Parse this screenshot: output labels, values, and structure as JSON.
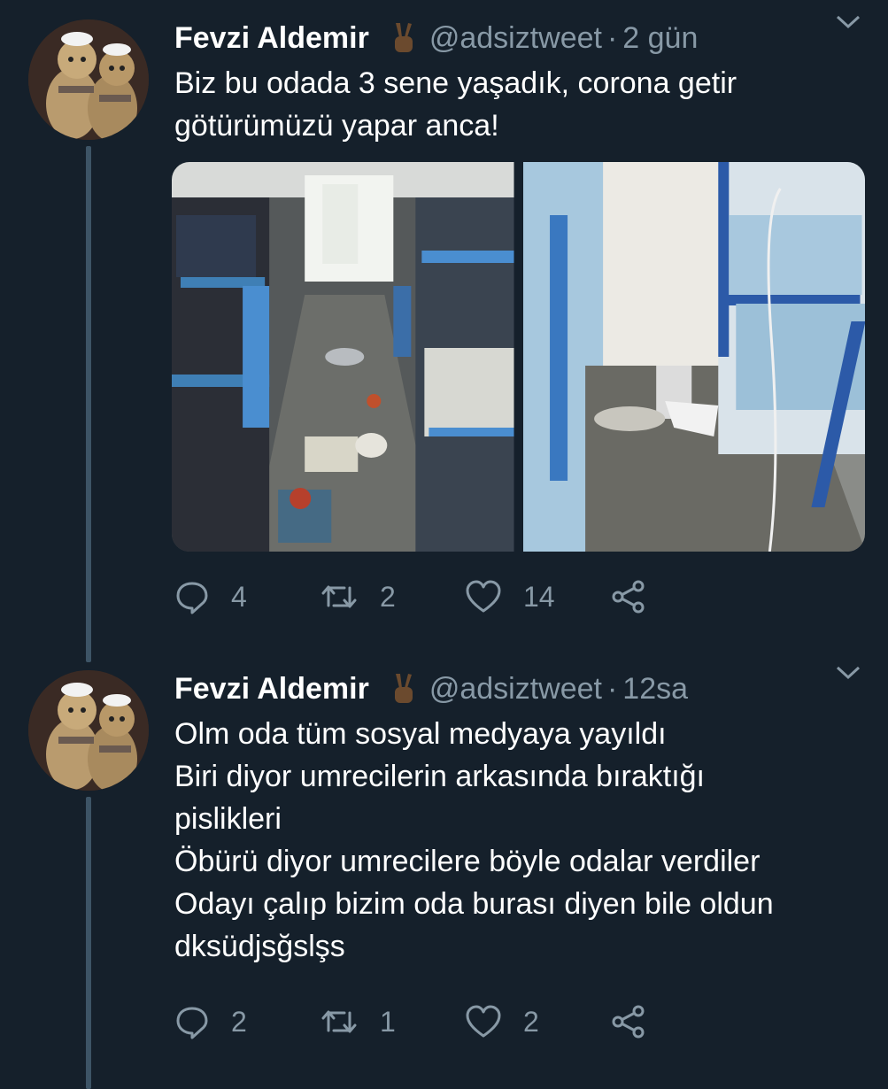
{
  "tweets": [
    {
      "author_name": "Fevzi Aldemir",
      "author_emoji": "victory-hand",
      "handle": "@adsiztweet",
      "time": "2 gün",
      "text": "Biz bu odada 3 sene yaşadık, corona getir\ngötürümüzü yapar anca!",
      "media_count": 2,
      "replies": "4",
      "retweets": "2",
      "likes": "14"
    },
    {
      "author_name": "Fevzi Aldemir",
      "author_emoji": "victory-hand",
      "handle": "@adsiztweet",
      "time": "12sa",
      "text": "Olm oda tüm sosyal medyaya yayıldı\nBiri diyor umrecilerin arkasında bıraktığı\npislikleri\nÖbürü diyor umrecilere böyle odalar verdiler\nOdayı çalıp bizim oda burası diyen bile oldun\ndksüdjsğslşs",
      "replies": "2",
      "retweets": "1",
      "likes": "2"
    }
  ],
  "colors": {
    "background": "#15202b",
    "secondary_text": "#8899a6",
    "thread_line": "#3d5466"
  }
}
